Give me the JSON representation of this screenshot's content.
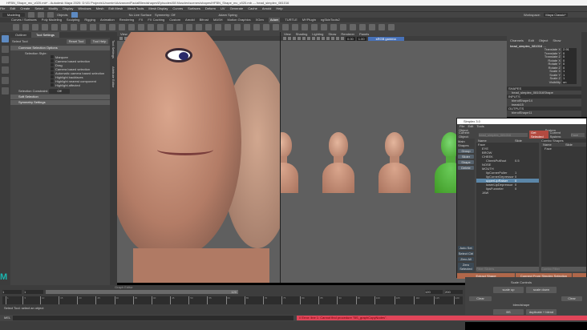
{
  "window": {
    "title": "HFBN_Shape_mc_v020.mb* - Autodesk Maya 2020: D:\\01 Projects\\Unomim\\AdvancedFacialBlendshapes\\Episodes\\08 Muscles\\scenes\\shapes\\HFBN_Shape_mc_v020.mb --- head_simplex_081016"
  },
  "menus": [
    "File",
    "Edit",
    "Create",
    "Select",
    "Modify",
    "Display",
    "Windows",
    "Mesh",
    "Edit Mesh",
    "Mesh Tools",
    "Mesh Display",
    "Curves",
    "Surfaces",
    "Deform",
    "UV",
    "Generate",
    "Cache",
    "Arnold",
    "Help"
  ],
  "status": {
    "mode": "Modeling",
    "objects": "Objects",
    "live_surface": "No Live Surface",
    "symmetry": "Symmetry: Off",
    "workspace_label": "Workspace:",
    "workspace": "Maya Classic*",
    "spring": "Adam Spring"
  },
  "shelf_tabs": [
    "Curves / Surfaces",
    "Poly Modeling",
    "Sculpting",
    "Rigging",
    "Animation",
    "Rendering",
    "FX",
    "FX Caching",
    "Custom",
    "Arnold",
    "Bifrost",
    "MASH",
    "Motion Graphics",
    "XGen",
    "Adam",
    "TURTLE",
    "MYPlugin",
    "ngSkinTools2"
  ],
  "tool_settings": {
    "tabs": [
      "Outliner",
      "Tool Settings"
    ],
    "tool": "Select Tool",
    "reset": "Reset Tool",
    "help": "Tool Help",
    "section": "Common Selection Options",
    "style_label": "Selection Style:",
    "options": [
      "Marquee",
      "Camera based selection",
      "Drag",
      "Camera based selection",
      "Automatic camera based selection",
      "Highlight backfaces",
      "Highlight nearest component",
      "Highlight affected"
    ],
    "constraint_label": "Selection Constraint:",
    "constraint": "Off",
    "soft": "Soft Selection",
    "symmetry": "Symmetry Settings"
  },
  "side_strips": [
    "Attribute Editor",
    "Tool Settings"
  ],
  "viewport": {
    "menus": [
      "View",
      "Shading",
      "Lighting",
      "Show",
      "Renderer",
      "Panels"
    ],
    "camera_value1": "0.00",
    "camera_value2": "1.00",
    "color_space": "sRGB gamma"
  },
  "channel_box": {
    "menus": [
      "Channels",
      "Edit",
      "Object",
      "Show"
    ],
    "object": "head_simplex_081016 ...",
    "attrs": [
      [
        "Translate X",
        "2.91"
      ],
      [
        "Translate Y",
        "0"
      ],
      [
        "Translate Z",
        "0"
      ],
      [
        "Rotate X",
        "0"
      ],
      [
        "Rotate Y",
        "0"
      ],
      [
        "Rotate Z",
        "0"
      ],
      [
        "Scale X",
        "1"
      ],
      [
        "Scale Y",
        "1"
      ],
      [
        "Scale Z",
        "1"
      ],
      [
        "Visibility",
        "on"
      ]
    ],
    "shapes_label": "SHAPES",
    "shape": "head_simplex_081016Shape",
    "inputs_label": "INPUTS",
    "inputs": [
      "blendShape14",
      "tweak15"
    ],
    "outputs_label": "OUTPUTS",
    "outputs": [
      "blendShape11"
    ]
  },
  "simplex": {
    "title": "Simplex 3.0",
    "menus": [
      "File",
      "Edit",
      "Tools"
    ],
    "object_label": "Object",
    "current_object_label": "Current Object:",
    "current_object": "head_simplex_081016",
    "get_selected": "Get Selected",
    "system_label": "System",
    "current_system_label": "Current System:",
    "current_system": "Face",
    "main_shapes": "Main Shapes",
    "group": "Group",
    "slider": "Slider",
    "shape": "Shape",
    "delete": "Delete",
    "col_name": "Name",
    "col_slide": "Slide",
    "tree": [
      {
        "name": "Face",
        "val": ""
      },
      {
        "name": "EYE",
        "val": ""
      },
      {
        "name": "BROW",
        "val": ""
      },
      {
        "name": "CHEEK",
        "val": ""
      },
      {
        "name": "CheekPuff/out",
        "val": "0.5"
      },
      {
        "name": "NOSE",
        "val": ""
      },
      {
        "name": "MOUTH",
        "val": ""
      },
      {
        "name": "lipCornerPuller",
        "val": "1"
      },
      {
        "name": "lipCornerDepressor",
        "val": "0"
      },
      {
        "name": "upperLipRaiser",
        "val": "0"
      },
      {
        "name": "lowerLipDepressor",
        "val": "0"
      },
      {
        "name": "lipsFunneler",
        "val": "0"
      },
      {
        "name": "JAW",
        "val": ""
      }
    ],
    "combo_shapes": "Combo Shapes",
    "combo_tree": [
      "Face"
    ],
    "auto_set": "Auto Set",
    "select_ctrl": "Select Ctrl",
    "zero_all": "Zero All",
    "zero_selected": "Zero Selected",
    "filter_placeholder": "Filter Sliders",
    "combo_filter_placeholder": "Combo Filter",
    "extract": "Extract Shape",
    "connect": "Connect From Simplex Selection"
  },
  "lower_right": {
    "scale_controls": "Scale Controls",
    "scale_up": "scale up",
    "scale_down": "scale down",
    "clear": "Clear",
    "blendshape": "blendshape",
    "btn1": "BS",
    "btn2": "duplicate + blend"
  },
  "timeline": {
    "start": "1",
    "end": "1",
    "range_end": "120",
    "max1": "120",
    "max2": "200",
    "ticks": [
      "1",
      "5",
      "10",
      "15",
      "20",
      "25",
      "30",
      "35",
      "40",
      "45",
      "50",
      "55",
      "60",
      "65",
      "70",
      "75",
      "80",
      "85",
      "90",
      "95",
      "100",
      "105",
      "110",
      "115",
      "120"
    ],
    "graph_editor": "Graph Editor"
  },
  "help_line": "Select Tool: select an object",
  "cmd": {
    "lang": "MEL",
    "error": "// Error: line 1: Cannot find procedure \"BS_graphCopyNodes\"."
  }
}
